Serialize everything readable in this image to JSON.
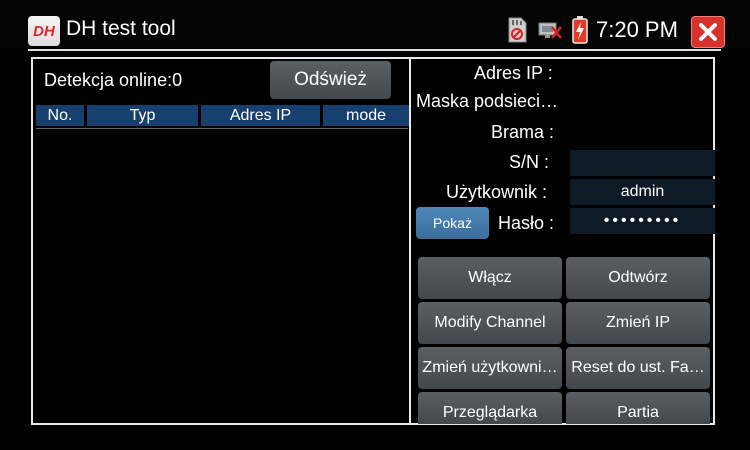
{
  "app": {
    "logo_text": "DH",
    "title": "DH test tool"
  },
  "status_bar": {
    "time": "7:20 PM",
    "icons": [
      "sd-card-icon",
      "network-disconnected-icon",
      "battery-charging-icon"
    ]
  },
  "detection": {
    "label": "Detekcja online:0",
    "refresh_label": "Odśwież"
  },
  "table": {
    "columns": [
      "No.",
      "Typ",
      "Adres IP",
      "mode"
    ],
    "rows": []
  },
  "form": {
    "ip_label": "Adres IP :",
    "mask_label": "Maska podsieci…",
    "gateway_label": "Brama :",
    "sn_label": "S/N :",
    "sn_value": "",
    "user_label": "Użytkownik :",
    "user_value": "admin",
    "password_label": "Hasło :",
    "password_value": "•••••••••",
    "show_label": "Pokaż"
  },
  "actions": {
    "enable": "Włącz",
    "play": "Odtwórz",
    "modify_channel": "Modify Channel",
    "change_ip": "Zmień IP",
    "change_user": "Zmień użytkowni…",
    "reset_factory": "Reset do ust. Fa…",
    "browser": "Przeglądarka",
    "batch": "Partia"
  },
  "colors": {
    "background": "#000000",
    "header_blue": "#17406e",
    "button_gray": "#4f5458",
    "pokaz_blue": "#4a7fae",
    "close_red": "#d9312c",
    "logo_red": "#e1262b"
  }
}
